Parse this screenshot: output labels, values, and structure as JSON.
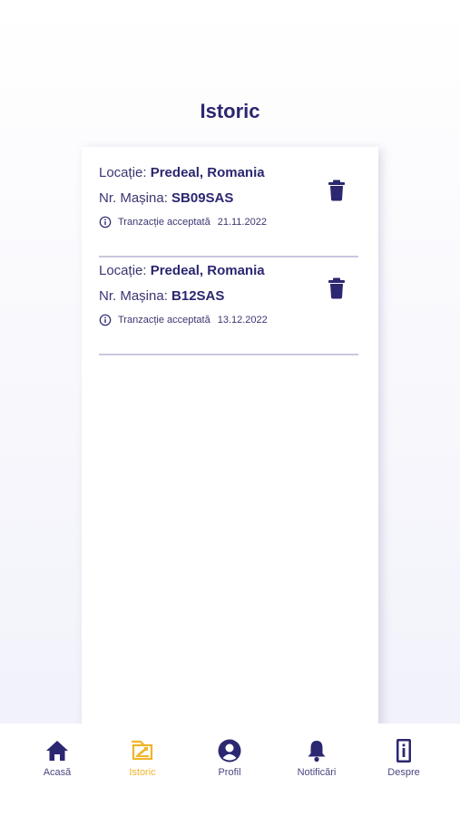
{
  "page": {
    "title": "Istoric"
  },
  "history": {
    "items": [
      {
        "location_label": "Locație: ",
        "location_value": "Predeal, Romania",
        "plate_label": "Nr. Mașina: ",
        "plate_value": "SB09SAS",
        "status": "Tranzacție acceptată",
        "date": "21.11.2022"
      },
      {
        "location_label": "Locație: ",
        "location_value": "Predeal, Romania",
        "plate_label": "Nr. Mașina: ",
        "plate_value": "B12SAS",
        "status": "Tranzacție acceptată",
        "date": "13.12.2022"
      }
    ]
  },
  "nav": {
    "items": [
      {
        "label": "Acasă",
        "icon": "home-icon",
        "active": false
      },
      {
        "label": "Istoric",
        "icon": "history-icon",
        "active": true
      },
      {
        "label": "Profil",
        "icon": "profile-icon",
        "active": false
      },
      {
        "label": "Notificări",
        "icon": "bell-icon",
        "active": false
      },
      {
        "label": "Despre",
        "icon": "info-phone-icon",
        "active": false
      }
    ]
  },
  "colors": {
    "primary": "#2b2770",
    "accent": "#f0b528",
    "divider": "#c9c8dd"
  }
}
